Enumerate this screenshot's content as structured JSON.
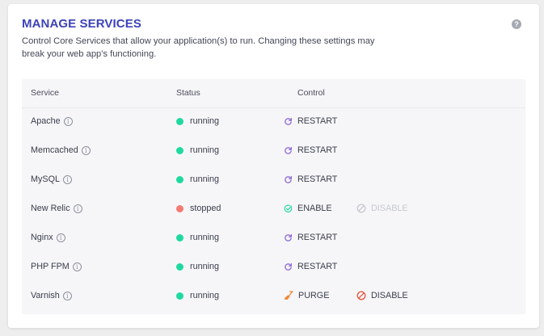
{
  "header": {
    "title": "MANAGE SERVICES",
    "help_glyph": "?",
    "description": "Control Core Services that allow your application(s) to run. Changing these settings may break your web app's functioning."
  },
  "table": {
    "columns": [
      "Service",
      "Status",
      "Control"
    ],
    "rows": [
      {
        "service": "Apache",
        "status": "running",
        "status_color": "#1fd9a0",
        "controls": [
          {
            "label": "RESTART",
            "icon": "restart-icon",
            "enabled": true
          }
        ]
      },
      {
        "service": "Memcached",
        "status": "running",
        "status_color": "#1fd9a0",
        "controls": [
          {
            "label": "RESTART",
            "icon": "restart-icon",
            "enabled": true
          }
        ]
      },
      {
        "service": "MySQL",
        "status": "running",
        "status_color": "#1fd9a0",
        "controls": [
          {
            "label": "RESTART",
            "icon": "restart-icon",
            "enabled": true
          }
        ]
      },
      {
        "service": "New Relic",
        "status": "stopped",
        "status_color": "#f47b74",
        "controls": [
          {
            "label": "ENABLE",
            "icon": "check-circle-icon",
            "enabled": true
          },
          {
            "label": "DISABLE",
            "icon": "ban-icon",
            "enabled": false
          }
        ]
      },
      {
        "service": "Nginx",
        "status": "running",
        "status_color": "#1fd9a0",
        "controls": [
          {
            "label": "RESTART",
            "icon": "restart-icon",
            "enabled": true
          }
        ]
      },
      {
        "service": "PHP FPM",
        "status": "running",
        "status_color": "#1fd9a0",
        "controls": [
          {
            "label": "RESTART",
            "icon": "restart-icon",
            "enabled": true
          }
        ]
      },
      {
        "service": "Varnish",
        "status": "running",
        "status_color": "#1fd9a0",
        "controls": [
          {
            "label": "PURGE",
            "icon": "broom-icon",
            "enabled": true
          },
          {
            "label": "DISABLE",
            "icon": "ban-icon",
            "enabled": true
          }
        ]
      }
    ]
  },
  "colors": {
    "accent": "#3d43b8",
    "restart_icon": "#8f6bd6",
    "enable_icon": "#1fd9a0",
    "disable_icon": "#e8563f",
    "purge_icon": "#f0883a",
    "disabled": "#c7c9d1"
  }
}
